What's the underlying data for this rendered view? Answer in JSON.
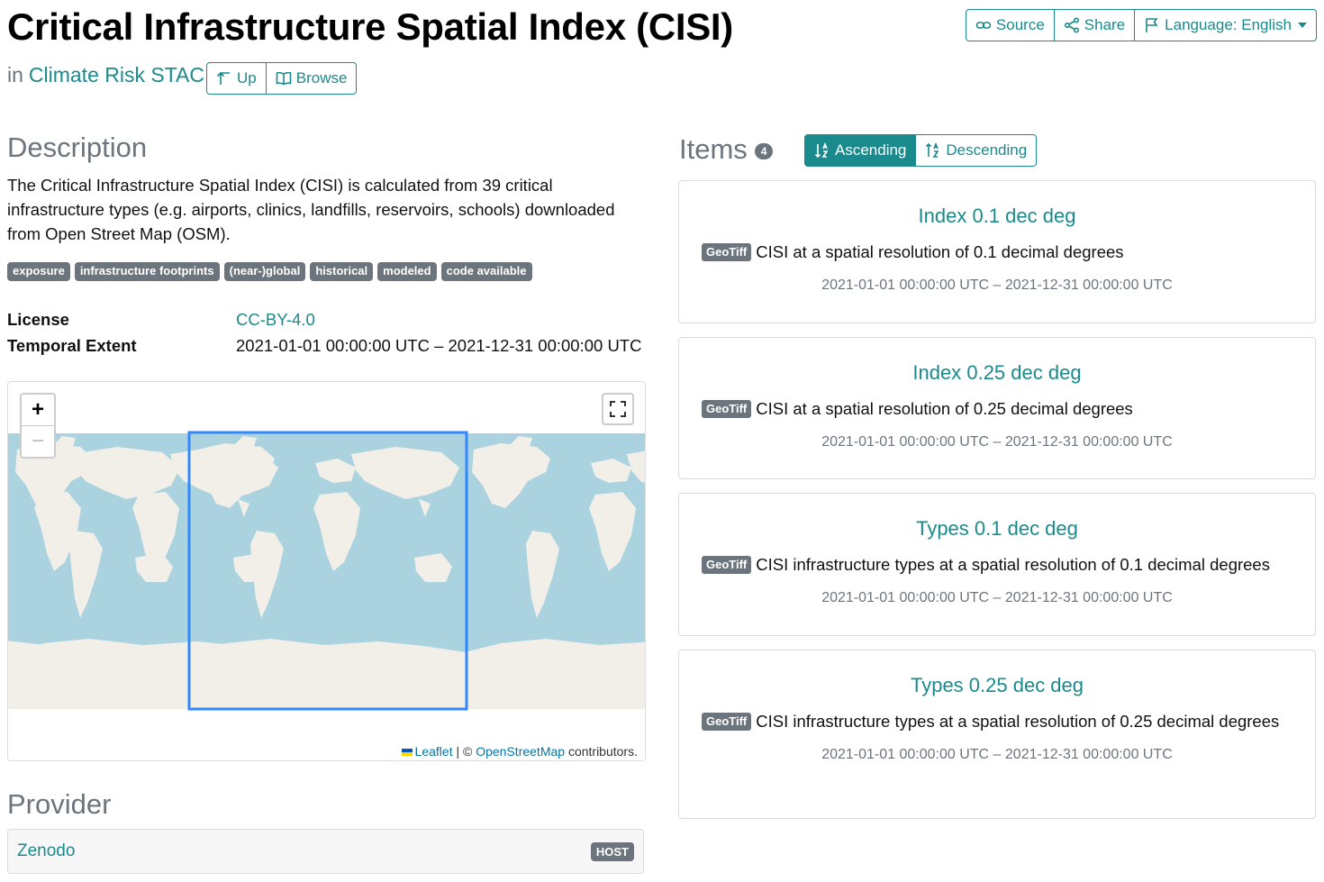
{
  "title": "Critical Infrastructure Spatial Index (CISI)",
  "breadcrumb": {
    "prefix": "in",
    "parent": "Climate Risk STAC"
  },
  "nav": {
    "up": "Up",
    "browse": "Browse"
  },
  "actions": {
    "source": "Source",
    "share": "Share",
    "language": "Language: English"
  },
  "description": {
    "heading": "Description",
    "text": "The Critical Infrastructure Spatial Index (CISI) is calculated from 39 critical infrastructure types (e.g. airports, clinics, landfills, reservoirs, schools) downloaded from Open Street Map (OSM).",
    "keywords": [
      "exposure",
      "infrastructure footprints",
      "(near-)global",
      "historical",
      "modeled",
      "code available"
    ]
  },
  "metadata": {
    "license_label": "License",
    "license_value": "CC-BY-4.0",
    "temporal_label": "Temporal Extent",
    "temporal_value": "2021-01-01 00:00:00 UTC – 2021-12-31 00:00:00 UTC"
  },
  "map": {
    "zoom_in": "+",
    "zoom_out": "−",
    "attribution": {
      "leaflet": "Leaflet",
      "sep": " | © ",
      "osm": "OpenStreetMap",
      "suffix": " contributors."
    }
  },
  "provider": {
    "heading": "Provider",
    "name": "Zenodo",
    "role": "HOST"
  },
  "items": {
    "heading": "Items",
    "count": "4",
    "sort_asc": "Ascending",
    "sort_desc": "Descending",
    "list": [
      {
        "title": "Index 0.1 dec deg",
        "badge": "GeoTiff",
        "desc": "CISI at a spatial resolution of 0.1 decimal degrees",
        "time": "2021-01-01 00:00:00 UTC – 2021-12-31 00:00:00 UTC"
      },
      {
        "title": "Index 0.25 dec deg",
        "badge": "GeoTiff",
        "desc": "CISI at a spatial resolution of 0.25 decimal degrees",
        "time": "2021-01-01 00:00:00 UTC – 2021-12-31 00:00:00 UTC"
      },
      {
        "title": "Types 0.1 dec deg",
        "badge": "GeoTiff",
        "desc": "CISI infrastructure types at a spatial resolution of 0.1 decimal degrees",
        "time": "2021-01-01 00:00:00 UTC – 2021-12-31 00:00:00 UTC"
      },
      {
        "title": "Types 0.25 dec deg",
        "badge": "GeoTiff",
        "desc": "CISI infrastructure types at a spatial resolution of 0.25 decimal degrees",
        "time": "2021-01-01 00:00:00 UTC – 2021-12-31 00:00:00 UTC"
      }
    ]
  },
  "colors": {
    "accent": "#1a8a8d",
    "badge": "#6c757d",
    "ocean": "#aad3df",
    "land": "#f2efe9",
    "bbox": "#3388ff"
  }
}
